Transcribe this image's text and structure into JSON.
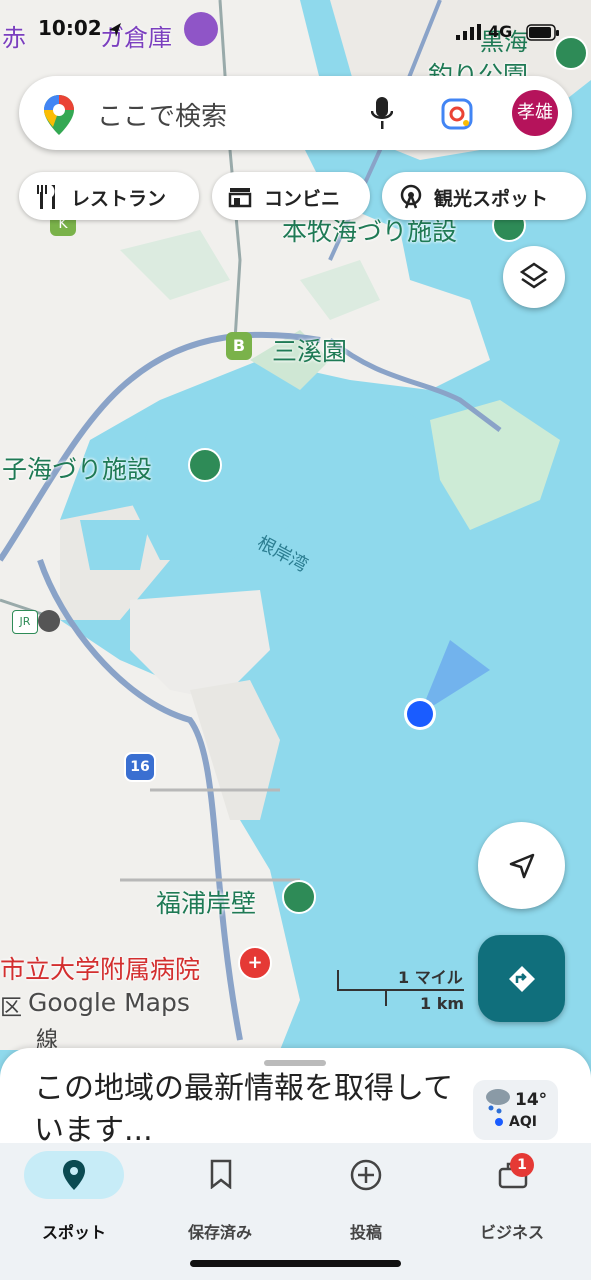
{
  "status_bar": {
    "time": "10:02",
    "network": "4G"
  },
  "search": {
    "placeholder": "ここで検索",
    "avatar_text": "孝雄"
  },
  "chips": [
    {
      "label": "レストラン",
      "icon": "fork-knife-icon"
    },
    {
      "label": "コンビニ",
      "icon": "store-icon"
    },
    {
      "label": "観光スポット",
      "icon": "ferris-wheel-icon"
    }
  ],
  "map": {
    "labels": {
      "top_left_partial": "赤",
      "top_left_warehouse": "ガ倉庫",
      "top_right_1": "黒海",
      "top_right_2": "釣り公園",
      "honmoku": "本牧海づり施設",
      "sankeien": "三溪園",
      "isogo": "子海づり施設",
      "negishi_bay": "根岸湾",
      "fukuura": "福浦岸壁",
      "hospital": "市立大学附属病院",
      "ward_partial": "区",
      "line_partial": "線",
      "route_16": "16",
      "badge_b": "B",
      "badge_k": "K",
      "jr": "JR"
    },
    "scale": {
      "miles": "1 マイル",
      "km": "1 km"
    },
    "logo": "Google Maps"
  },
  "sheet": {
    "text": "この地域の最新情報を取得しています..."
  },
  "weather": {
    "temperature": "14°",
    "aqi_label": "AQI"
  },
  "bottom_nav": [
    {
      "label": "スポット",
      "icon": "location-pin-icon",
      "active": true
    },
    {
      "label": "保存済み",
      "icon": "bookmark-icon",
      "active": false
    },
    {
      "label": "投稿",
      "icon": "plus-circle-icon",
      "active": false
    },
    {
      "label": "ビジネス",
      "icon": "business-icon",
      "active": false,
      "badge": "1"
    }
  ],
  "colors": {
    "water": "#8fd9ec",
    "accent": "#106f7c",
    "avatar": "#b5135b",
    "location_dot": "#1a5cff"
  }
}
